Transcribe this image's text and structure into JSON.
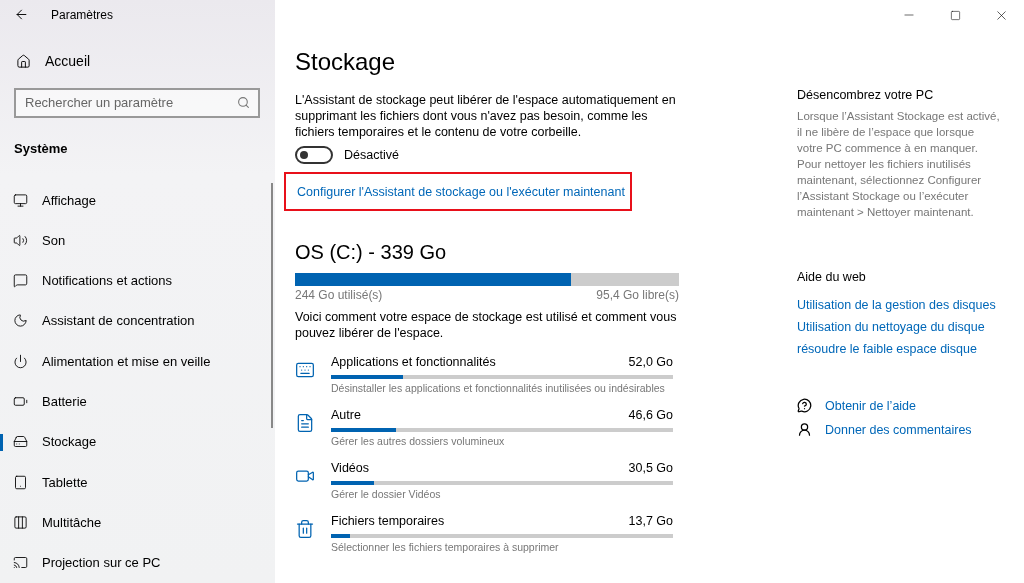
{
  "window": {
    "title": "Paramètres"
  },
  "sidebar": {
    "home": "Accueil",
    "search": {
      "placeholder": "Rechercher un paramètre"
    },
    "section": "Système",
    "items": [
      {
        "label": "Affichage",
        "selected": false
      },
      {
        "label": "Son",
        "selected": false
      },
      {
        "label": "Notifications et actions",
        "selected": false
      },
      {
        "label": "Assistant de concentration",
        "selected": false
      },
      {
        "label": "Alimentation et mise en veille",
        "selected": false
      },
      {
        "label": "Batterie",
        "selected": false
      },
      {
        "label": "Stockage",
        "selected": true
      },
      {
        "label": "Tablette",
        "selected": false
      },
      {
        "label": "Multitâche",
        "selected": false
      },
      {
        "label": "Projection sur ce PC",
        "selected": false
      }
    ]
  },
  "main": {
    "title": "Stockage",
    "description": "L'Assistant de stockage peut libérer de l'espace automatiquement en supprimant les fichiers dont vous n'avez pas besoin, comme les fichiers temporaires et le contenu de votre corbeille.",
    "toggle": {
      "on": false,
      "label": "Désactivé"
    },
    "link": {
      "text": "Configurer l'Assistant de stockage ou l'exécuter maintenant",
      "highlighted": true
    },
    "drive": {
      "title": "OS (C:) - 339 Go",
      "level": 0.72,
      "used": "244 Go utilisé(s)",
      "free": "95,4 Go libre(s)"
    },
    "intro": "Voici comment votre espace de stockage est utilisé et comment vous pouvez libérer de l'espace.",
    "categories": [
      {
        "name": "Applications et fonctionnalités",
        "size": "52,0 Go",
        "level": 0.21,
        "hint": "Désinstaller les applications et fonctionnalités inutilisées ou indésirables"
      },
      {
        "name": "Autre",
        "size": "46,6 Go",
        "level": 0.19,
        "hint": "Gérer les autres dossiers volumineux"
      },
      {
        "name": "Vidéos",
        "size": "30,5 Go",
        "level": 0.125,
        "hint": "Gérer le dossier Vidéos"
      },
      {
        "name": "Fichiers temporaires",
        "size": "13,7 Go",
        "level": 0.056,
        "hint": "Sélectionner les fichiers temporaires à supprimer"
      }
    ]
  },
  "aside": {
    "title": "Désencombrez votre PC",
    "text": "Lorsque l’Assistant Stockage est activé, il ne libère de l’espace que lorsque votre PC commence à en manquer. Pour nettoyer les fichiers inutilisés maintenant, sélectionnez Configurer l’Assistant Stockage ou l’exécuter maintenant > Nettoyer maintenant.",
    "help_title": "Aide du web",
    "links": [
      "Utilisation de la gestion des disques",
      "Utilisation du nettoyage du disque",
      "résoudre le faible espace disque"
    ],
    "actions": [
      "Obtenir de l’aide",
      "Donner des commentaires"
    ]
  }
}
